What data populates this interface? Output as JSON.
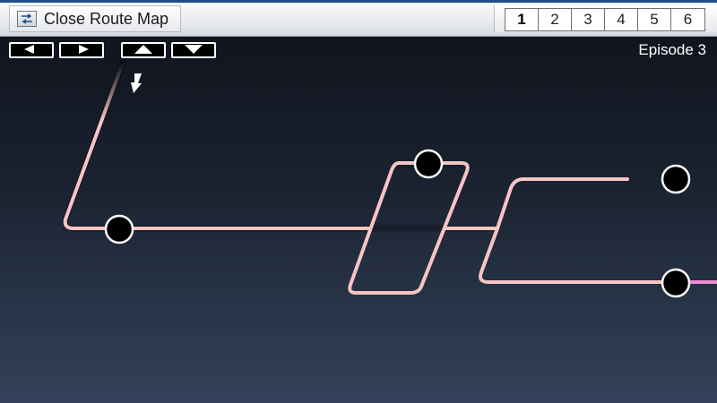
{
  "toolbar": {
    "close_label": "Close Route Map",
    "page_tabs": [
      "1",
      "2",
      "3",
      "4",
      "5",
      "6"
    ],
    "active_tab": "1"
  },
  "nav": {
    "left_icon": "arrow-left-icon",
    "right_icon": "arrow-right-icon",
    "up_icon": "arrow-up-icon",
    "down_icon": "arrow-down-icon"
  },
  "episode_label": "Episode 3",
  "colors": {
    "route_pink": "#f7c4c6",
    "route_orange": "#f5b45a",
    "route_magenta": "#f08ccf",
    "node_fill": "#000000",
    "node_stroke": "#ffffff",
    "toolbar_blue": "#1e4f8a"
  }
}
